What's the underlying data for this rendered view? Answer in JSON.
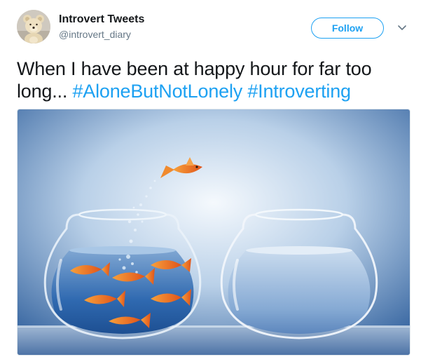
{
  "tweet": {
    "display_name": "Introvert Tweets",
    "handle": "@introvert_diary",
    "follow_label": "Follow",
    "text_plain": "When I have been at happy hour for far too long...",
    "hashtags": [
      "#AloneButNotLonely",
      "#Introverting"
    ],
    "avatar_icon": "teddy-bear-avatar",
    "menu_icon": "chevron-down-icon",
    "media_subject": "goldfish-jumping-between-bowls-photo"
  },
  "colors": {
    "link": "#1da1f2",
    "text": "#14171a",
    "secondary": "#657786",
    "background": "#ffffff"
  }
}
